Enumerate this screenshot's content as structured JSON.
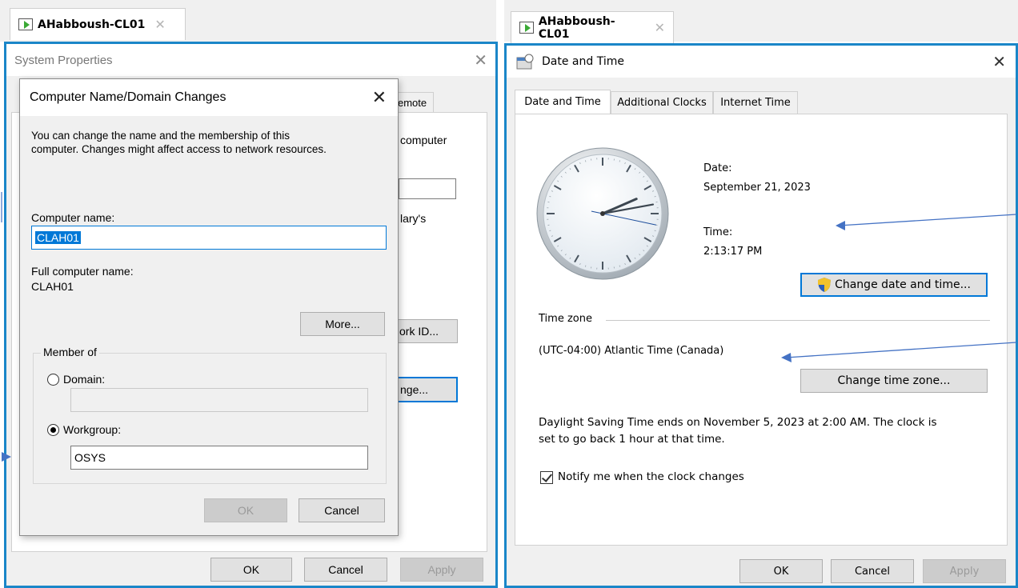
{
  "left_vm": {
    "tab_label": "AHabboush-CL01",
    "window_title": "System Properties",
    "partial_tab": "emote",
    "partial_computer": "computer",
    "partial_arys": "lary's",
    "partial_network_id": "ork ID...",
    "partial_change": "nge...",
    "ok_label": "OK",
    "cancel_label": "Cancel",
    "apply_label": "Apply"
  },
  "dialog": {
    "title": "Computer Name/Domain Changes",
    "description_line1": "You can change the name and the membership of this",
    "description_line2": "computer. Changes might affect access to network resources.",
    "computer_name_label": "Computer name:",
    "computer_name_value": "CLAH01",
    "full_name_label": "Full computer name:",
    "full_name_value": "CLAH01",
    "more_button": "More...",
    "member_of_label": "Member of",
    "domain_label": "Domain:",
    "domain_value": "",
    "workgroup_label": "Workgroup:",
    "workgroup_value": "OSYS",
    "ok_label": "OK",
    "cancel_label": "Cancel"
  },
  "right_vm": {
    "tab_label": "AHabboush-CL01",
    "window_title": "Date and Time",
    "tabs": [
      {
        "label": "Date and Time",
        "active": true
      },
      {
        "label": "Additional Clocks",
        "active": false
      },
      {
        "label": "Internet Time",
        "active": false
      }
    ],
    "date_label": "Date:",
    "date_value": "September 21, 2023",
    "time_label": "Time:",
    "time_value": "2:13:17 PM",
    "change_datetime_button": "Change date and time...",
    "time_zone_label": "Time zone",
    "time_zone_value": "(UTC-04:00) Atlantic Time (Canada)",
    "change_timezone_button": "Change time zone...",
    "dst_line1": "Daylight Saving Time ends on November 5, 2023 at 2:00 AM. The clock is",
    "dst_line2": "set to go back 1 hour at that time.",
    "notify_label": "Notify me when the clock changes",
    "notify_checked": true,
    "ok_label": "OK",
    "cancel_label": "Cancel",
    "apply_label": "Apply"
  },
  "clock": {
    "hours": 2,
    "minutes": 13,
    "seconds": 17
  },
  "colors": {
    "accent": "#1a86c8",
    "selection": "#0078d7",
    "arrow": "#4472c4"
  }
}
